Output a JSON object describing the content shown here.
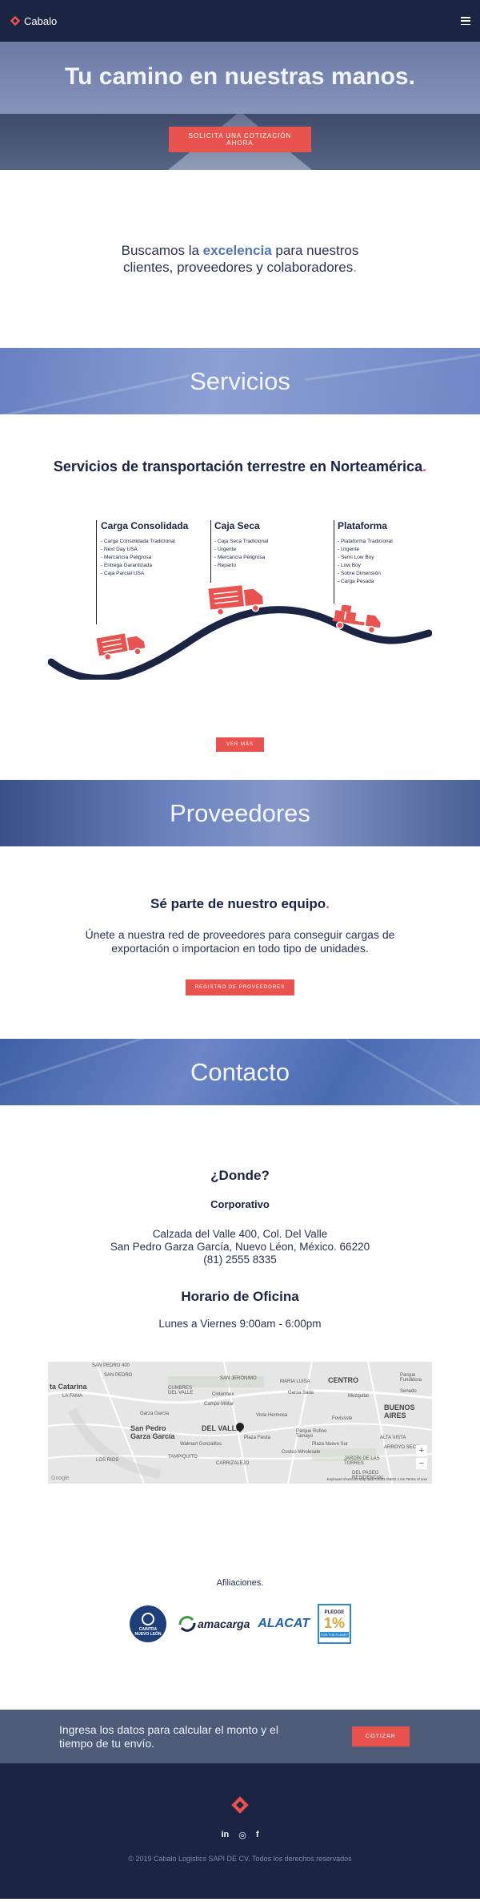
{
  "nav": {
    "brand": "Cabalo",
    "menu_icon": "hamburger-menu-icon"
  },
  "hero": {
    "title": "Tu camino en nuestras manos.",
    "cta": "SOLICITA UNA COTIZACIÓN AHORA"
  },
  "intro": {
    "before": "Buscamos la ",
    "highlight": "excelencia",
    "after": " para nuestros clientes, proveedores y colaboradores",
    "period": "."
  },
  "servicios": {
    "band_title": "Servicios",
    "heading": "Servicios de transportación terrestre en Norteamérica",
    "period": ".",
    "columns": [
      {
        "title": "Carga Consolidada",
        "items": [
          "- Carga Consolidada Tradicional",
          "- Next Day USA",
          "- Mercancía Peligrosa",
          "- Entrega Garantizada",
          "- Caja Parcial USA"
        ]
      },
      {
        "title": "Caja Seca",
        "items": [
          "- Caja Seca Tradicional",
          "- Urgente",
          "- Mercancía Peligrosa",
          "- Reparto"
        ]
      },
      {
        "title": "Plataforma",
        "items": [
          "- Plataforma Tradicional",
          "- Urgente",
          "- Semi Low Boy",
          "- Low Boy",
          "- Sobre Dimensión",
          "- Carga Pesada"
        ]
      }
    ],
    "more_button": "VER MÁS"
  },
  "proveedores": {
    "band_title": "Proveedores",
    "heading": "Sé parte de nuestro equipo",
    "period": ".",
    "text": "Únete a nuestra red de proveedores para conseguir cargas de exportación o importacion en todo tipo de unidades.",
    "button": "REGISTRO DE PROVEEDORES"
  },
  "contacto": {
    "band_title": "Contacto",
    "where": "¿Donde?",
    "office": "Corporativo",
    "address_1": "Calzada del Valle 400, Col. Del Valle",
    "address_2": "San Pedro Garza García, Nuevo Léon, México. 66220",
    "phone": "(81) 2555 8335",
    "hours_title": "Horario de  Oficina",
    "hours": "Lunes a Viernes 9:00am - 6:00pm",
    "map": {
      "labels": [
        "SAN PEDRO 400",
        "SAN PEDRO",
        "ta Catarina",
        "LA FAMA",
        "Garza García",
        "San Pedro Garza García",
        "CUMBRES DEL VALLE",
        "Cintermex",
        "SAN JERÓNIMO",
        "Campo Militar",
        "MARIA LUISA",
        "CENTRO",
        "Parque Fundidora",
        "DEL VALLE",
        "Parque Rufino Tamayo",
        "Walmart Gonzalitos",
        "BUENOS AIRES",
        "Fovissste",
        "Costco Wholesale",
        "TAMPIQUITO",
        "CARRIZALEJO",
        "Plaza Fiesta",
        "Vista Hermosa",
        "Garza Sada",
        "ALTA VISTA",
        "ARROYO SECO",
        "JARDÍN DE LAS TORRES",
        "DEL PASEO RESIDENCIAL",
        "Mezquital",
        "Plaza Nuevo Sur",
        "Senado",
        "LOS RIOS"
      ],
      "zoom_in": "+",
      "zoom_out": "−",
      "attribution": "Keyboard shortcuts   Map data ©2021 INEGI   1 km   Terms of Use",
      "google": "Google"
    }
  },
  "afiliaciones": {
    "title": "Afiliaciones.",
    "logos": [
      {
        "name": "caintra-logo",
        "text": "CAINTRA",
        "sub": "NUEVO LEÓN"
      },
      {
        "name": "amacarga-logo",
        "text": "amacarga"
      },
      {
        "name": "alacat-logo",
        "text": "ALACAT"
      },
      {
        "name": "pledge-logo",
        "text": "PLEDGE",
        "big": "1%",
        "sub": "FOR THE PLANET"
      }
    ]
  },
  "quote": {
    "text": "Ingresa los datos para calcular el monto y el tiempo de tu envío.",
    "button": "COTIZAR"
  },
  "footer": {
    "social": [
      "in",
      "◎",
      "f"
    ],
    "copyright": "© 2019 Cabalo Logistics SAPI DE CV. Todos los derechos reservados"
  },
  "colors": {
    "navy": "#1b2442",
    "accent": "#e8534f",
    "blue": "#5175b8",
    "slate": "#4e5c79"
  }
}
